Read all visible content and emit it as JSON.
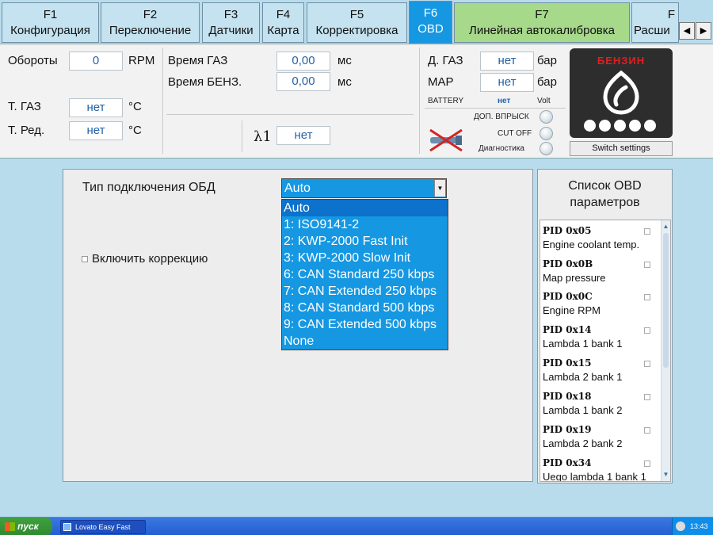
{
  "tabs": [
    {
      "key": "F1",
      "label": "Конфигурация"
    },
    {
      "key": "F2",
      "label": "Переключение"
    },
    {
      "key": "F3",
      "label": "Датчики"
    },
    {
      "key": "F4",
      "label": "Карта"
    },
    {
      "key": "F5",
      "label": "Корректировка"
    },
    {
      "key": "F6",
      "label": "OBD"
    },
    {
      "key": "F7",
      "label": "Линейная автокалибровка"
    },
    {
      "key": "F",
      "label": "Расши"
    }
  ],
  "top": {
    "rpm": {
      "label": "Обороты",
      "value": "0",
      "unit": "RPM"
    },
    "tgas": {
      "label": "Т. ГАЗ",
      "value": "нет",
      "unit": "°C"
    },
    "tred": {
      "label": "Т. Ред.",
      "value": "нет",
      "unit": "°C"
    },
    "gas_time": {
      "label": "Время ГАЗ",
      "value": "0,00",
      "unit": "мс"
    },
    "petrol_time": {
      "label": "Время БЕНЗ.",
      "value": "0,00",
      "unit": "мс"
    },
    "lambda": {
      "label": "λ1",
      "value": "нет"
    },
    "dgas": {
      "label": "Д. ГАЗ",
      "value": "нет",
      "unit": "бар"
    },
    "map": {
      "label": "MAP",
      "value": "нет",
      "unit": "бар"
    },
    "battery": {
      "label": "BATTERY",
      "value": "нет",
      "unit": "Volt"
    },
    "indicators": [
      "ДОП. ВПРЫСК",
      "CUT OFF",
      "Диагностика"
    ],
    "fuel_label": "БЕНЗИН",
    "switch_settings": "Switch settings"
  },
  "main": {
    "connection_label": "Тип подключения ОБД",
    "connection_value": "Auto",
    "connection_options": [
      "Auto",
      "1: ISO9141-2",
      "2: KWP-2000 Fast Init",
      "3: KWP-2000 Slow Init",
      "6: CAN Standard 250 kbps",
      "7: CAN Extended 250 kbps",
      "8: CAN Standard 500 kbps",
      "9: CAN Extended 500 kbps",
      "None"
    ],
    "correction_label": "Включить коррекцию"
  },
  "obd": {
    "title": "Список OBD параметров",
    "params": [
      {
        "pid": "PID 0x05",
        "name": "Engine coolant temp."
      },
      {
        "pid": "PID 0x0B",
        "name": "Map pressure"
      },
      {
        "pid": "PID 0x0C",
        "name": "Engine RPM"
      },
      {
        "pid": "PID 0x14",
        "name": "Lambda 1 bank 1"
      },
      {
        "pid": "PID 0x15",
        "name": "Lambda 2 bank 1"
      },
      {
        "pid": "PID 0x18",
        "name": "Lambda 1 bank 2"
      },
      {
        "pid": "PID 0x19",
        "name": "Lambda 2 bank 2"
      },
      {
        "pid": "PID 0x34",
        "name": "Uego lambda 1 bank 1"
      }
    ]
  },
  "taskbar": {
    "start": "пуск",
    "app": "Lovato Easy Fast",
    "clock": "13:43"
  },
  "colors": {
    "active_tab": "#1697e2",
    "calibration_tab": "#a7d98b",
    "background": "#b9dcec",
    "fuel_label": "#e02020"
  }
}
